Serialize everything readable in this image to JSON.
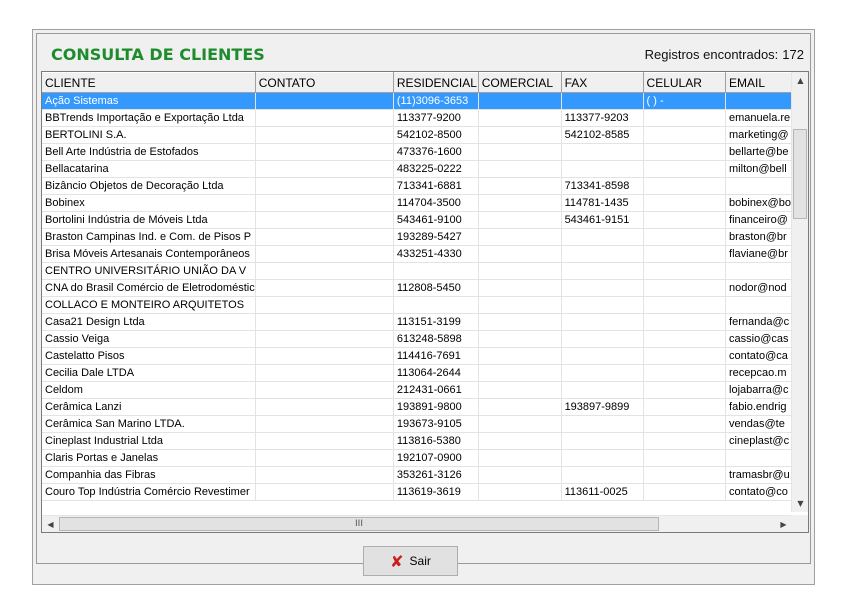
{
  "header": {
    "title": "CONSULTA DE CLIENTES",
    "count_label": "Registros encontrados:",
    "count_value": "172"
  },
  "columns": [
    "CLIENTE",
    "CONTATO",
    "RESIDENCIAL",
    "COMERCIAL",
    "FAX",
    "CELULAR",
    "EMAIL"
  ],
  "rows": [
    [
      "Ação Sistemas",
      "",
      "(11)3096-3653",
      "",
      "",
      "(  )   -",
      ""
    ],
    [
      "BBTrends Importação e Exportação Ltda",
      "",
      "113377-9200",
      "",
      "113377-9203",
      "",
      "emanuela.re"
    ],
    [
      "BERTOLINI S.A.",
      "",
      "542102-8500",
      "",
      "542102-8585",
      "",
      "marketing@"
    ],
    [
      "Bell Arte Indústria de Estofados",
      "",
      "473376-1600",
      "",
      "",
      "",
      "bellarte@be"
    ],
    [
      "Bellacatarina",
      "",
      "483225-0222",
      "",
      "",
      "",
      "milton@bell"
    ],
    [
      "Bizâncio Objetos de Decoração Ltda",
      "",
      "713341-6881",
      "",
      "713341-8598",
      "",
      ""
    ],
    [
      "Bobinex",
      "",
      "114704-3500",
      "",
      "114781-1435",
      "",
      "bobinex@bo"
    ],
    [
      "Bortolini Indústria de Móveis Ltda",
      "",
      "543461-9100",
      "",
      "543461-9151",
      "",
      "financeiro@"
    ],
    [
      "Braston Campinas Ind. e Com. de Pisos P",
      "",
      "193289-5427",
      "",
      "",
      "",
      "braston@br"
    ],
    [
      "Brisa Móveis Artesanais Contemporâneos",
      "",
      "433251-4330",
      "",
      "",
      "",
      "flaviane@br"
    ],
    [
      "CENTRO UNIVERSITÁRIO UNIÃO DA V",
      "",
      "",
      "",
      "",
      "",
      ""
    ],
    [
      "CNA do Brasil Comércio de Eletrodoméstic",
      "",
      "112808-5450",
      "",
      "",
      "",
      "nodor@nod"
    ],
    [
      "COLLACO E MONTEIRO ARQUITETOS",
      "",
      "",
      "",
      "",
      "",
      ""
    ],
    [
      "Casa21 Design Ltda",
      "",
      "113151-3199",
      "",
      "",
      "",
      "fernanda@c"
    ],
    [
      "Cassio Veiga",
      "",
      "613248-5898",
      "",
      "",
      "",
      "cassio@cas"
    ],
    [
      "Castelatto Pisos",
      "",
      "114416-7691",
      "",
      "",
      "",
      "contato@ca"
    ],
    [
      "Cecilia Dale LTDA",
      "",
      "113064-2644",
      "",
      "",
      "",
      "recepcao.m"
    ],
    [
      "Celdom",
      "",
      "212431-0661",
      "",
      "",
      "",
      "lojabarra@c"
    ],
    [
      "Cerâmica Lanzi",
      "",
      "193891-9800",
      "",
      "193897-9899",
      "",
      "fabio.endrig"
    ],
    [
      "Cerâmica San Marino LTDA.",
      "",
      "193673-9105",
      "",
      "",
      "",
      "vendas@te"
    ],
    [
      "Cineplast Industrial Ltda",
      "",
      "113816-5380",
      "",
      "",
      "",
      "cineplast@c"
    ],
    [
      "Claris Portas e Janelas",
      "",
      "192107-0900",
      "",
      "",
      "",
      ""
    ],
    [
      "Companhia das Fibras",
      "",
      "353261-3126",
      "",
      "",
      "",
      "tramasbr@u"
    ],
    [
      "Couro Top Indústria Comércio Revestimer",
      "",
      "113619-3619",
      "",
      "113611-0025",
      "",
      "contato@co"
    ]
  ],
  "selected_row": 0,
  "hscroll_label": "III",
  "exit_button": {
    "label": "Sair",
    "icon": "close-x-icon",
    "icon_color": "#c81e1e"
  },
  "colors": {
    "title": "#1e8c2c",
    "selection": "#3399ff"
  }
}
